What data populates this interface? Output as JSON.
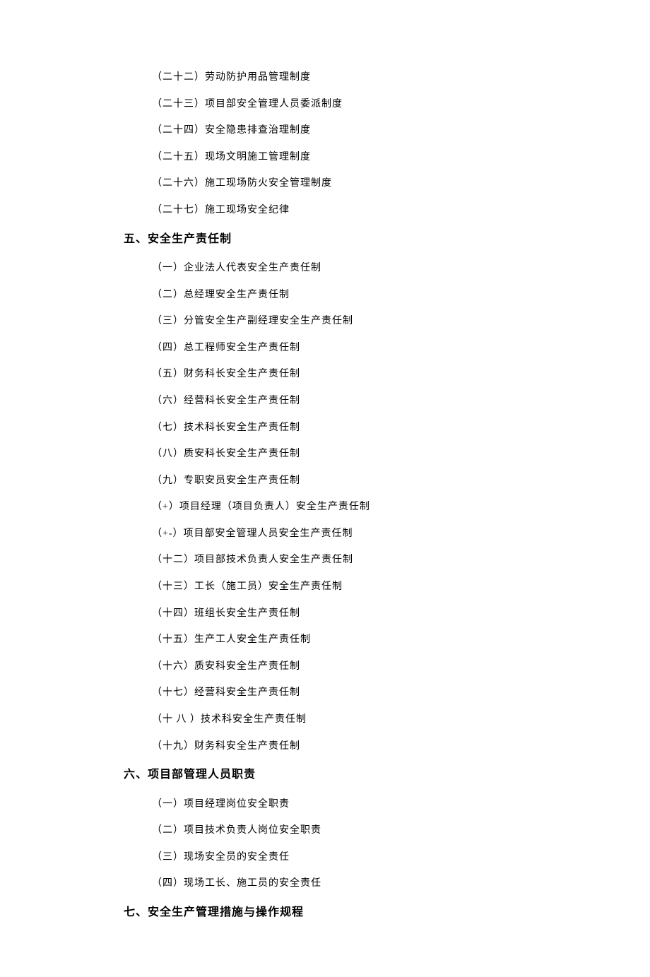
{
  "preItems": [
    {
      "label": "（二十二）劳动防护用品管理制度"
    },
    {
      "label": "（二十三）项目部安全管理人员委派制度"
    },
    {
      "label": "（二十四）安全隐患排查治理制度"
    },
    {
      "label": "（二十五）现场文明施工管理制度"
    },
    {
      "label": "（二十六）施工现场防火安全管理制度"
    },
    {
      "label": "（二十七）施工现场安全纪律"
    }
  ],
  "section5": {
    "heading": "五、安全生产责任制",
    "items": [
      {
        "label": "（一）企业法人代表安全生产责任制"
      },
      {
        "label": "（二）总经理安全生产责任制"
      },
      {
        "label": "（三）分管安全生产副经理安全生产责任制"
      },
      {
        "label": "（四）总工程师安全生产责任制"
      },
      {
        "label": "（五）财务科长安全生产责任制"
      },
      {
        "label": "（六）经营科长安全生产责任制"
      },
      {
        "label": "（七）技术科长安全生产责任制"
      },
      {
        "label": "（八）质安科长安全生产责任制"
      },
      {
        "label": "（九）专职安员安全生产责任制"
      },
      {
        "label": "（+）项目经理（项目负责人）安全生产责任制"
      },
      {
        "label": "（+-）项目部安全管理人员安全生产责任制"
      },
      {
        "label": "（十二）项目部技术负责人安全生产责任制"
      },
      {
        "label": "（十三）工长（施工员）安全生产责任制"
      },
      {
        "label": "（十四）班组长安全生产责任制"
      },
      {
        "label": "（十五）生产工人安全生产责任制"
      },
      {
        "label": "（十六）质安科安全生产责任制"
      },
      {
        "label": "（十七）经营科安全生产责任制"
      },
      {
        "label": "（十 八 ）技术科安全生产责任制",
        "spaced": true
      },
      {
        "label": "（十九）财务科安全生产责任制"
      }
    ]
  },
  "section6": {
    "heading": "六、项目部管理人员职责",
    "items": [
      {
        "label": "（一）项目经理岗位安全职责"
      },
      {
        "label": "（二）项目技术负责人岗位安全职责"
      },
      {
        "label": "（三）现场安全员的安全责任"
      },
      {
        "label": "（四）现场工长、施工员的安全责任"
      }
    ]
  },
  "section7": {
    "heading": "七、安全生产管理措施与操作规程"
  }
}
